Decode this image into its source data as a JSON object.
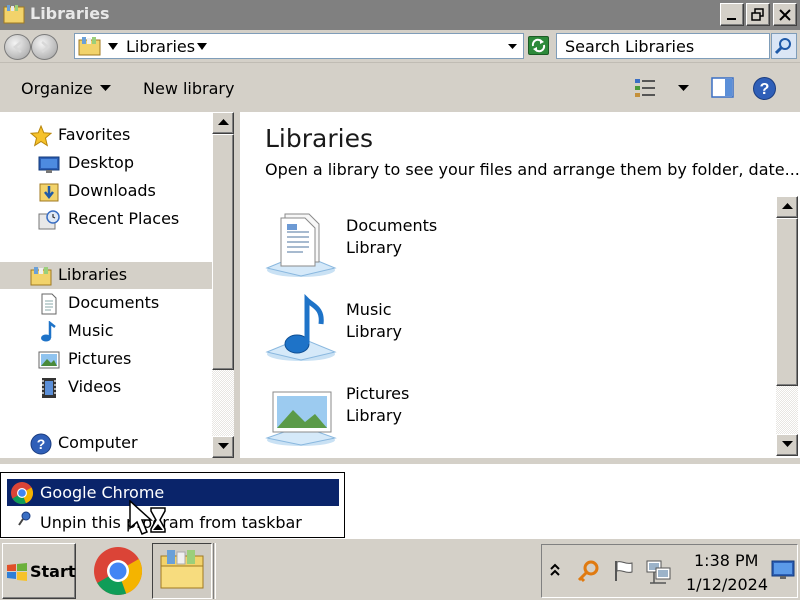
{
  "window": {
    "title": "Libraries"
  },
  "address": {
    "path": "Libraries",
    "search_placeholder": "Search Libraries"
  },
  "toolbar": {
    "organize_label": "Organize",
    "new_library_label": "New library"
  },
  "sidebar": {
    "items": [
      {
        "label": "Favorites",
        "icon": "star-icon"
      },
      {
        "label": "Desktop",
        "icon": "desktop-icon"
      },
      {
        "label": "Downloads",
        "icon": "downloads-icon"
      },
      {
        "label": "Recent Places",
        "icon": "recent-places-icon"
      },
      {
        "label": "Libraries",
        "icon": "libraries-icon",
        "selected": true
      },
      {
        "label": "Documents",
        "icon": "documents-icon"
      },
      {
        "label": "Music",
        "icon": "music-icon"
      },
      {
        "label": "Pictures",
        "icon": "pictures-icon"
      },
      {
        "label": "Videos",
        "icon": "videos-icon"
      },
      {
        "label": "Computer",
        "icon": "computer-icon"
      }
    ]
  },
  "content": {
    "heading": "Libraries",
    "subheading": "Open a library to see your files and arrange them by folder, date...",
    "libraries": [
      {
        "name": "Documents",
        "type": "Library",
        "icon": "documents-library-icon"
      },
      {
        "name": "Music",
        "type": "Library",
        "icon": "music-library-icon"
      },
      {
        "name": "Pictures",
        "type": "Library",
        "icon": "pictures-library-icon"
      }
    ]
  },
  "jumplist": {
    "items": [
      {
        "label": "Google Chrome",
        "icon": "chrome-icon",
        "highlighted": true
      },
      {
        "label": "Unpin this program from taskbar",
        "icon": "unpin-icon"
      }
    ]
  },
  "taskbar": {
    "start_label": "Start",
    "apps": [
      {
        "name": "Google Chrome",
        "icon": "chrome-icon"
      },
      {
        "name": "Windows Explorer",
        "icon": "explorer-icon",
        "active": true
      }
    ],
    "clock": {
      "time": "1:38 PM",
      "date": "1/12/2024"
    }
  },
  "colors": {
    "selection": "#0a246a",
    "chrome_face": "#d4d0c8",
    "title_bar": "#808080"
  }
}
